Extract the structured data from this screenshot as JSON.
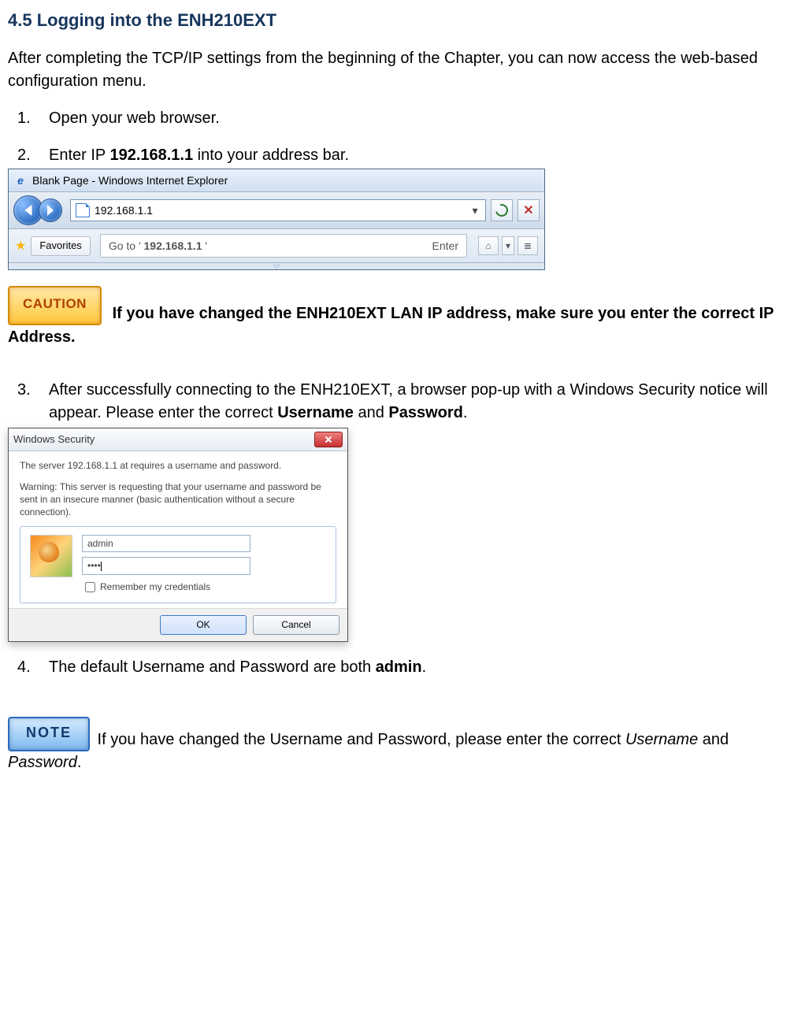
{
  "heading": "4.5 Logging into the ENH210EXT",
  "intro": "After completing the TCP/IP settings from the beginning of the Chapter, you can now access the web-based configuration menu.",
  "steps": {
    "s1": "Open your web browser.",
    "s2_pre": "Enter IP ",
    "s2_ip": "192.168.1.1",
    "s2_post": " into your address bar.",
    "s3_a": "After successfully connecting to the ENH210EXT, a browser pop-up with a Windows Security notice will appear. Please enter the correct ",
    "s3_user": "Username",
    "s3_and": " and ",
    "s3_pass": "Password",
    "s3_end": ".",
    "s4_a": "The default Username and Password are both ",
    "s4_val": "admin",
    "s4_end": "."
  },
  "caution": {
    "label": "CAUTION",
    "text": "If you have changed the ENH210EXT LAN IP address, make sure you enter the correct IP Address."
  },
  "note": {
    "label": "NOTE",
    "text_a": " If you have changed the Username and Password, please enter the correct ",
    "text_user": "Username",
    "text_and": " and ",
    "text_pass": "Password",
    "text_end": "."
  },
  "ie": {
    "title": "Blank Page - Windows Internet Explorer",
    "address": "192.168.1.1",
    "suggest_pre": "Go to ' ",
    "suggest_val": "192.168.1.1",
    "suggest_post": " '",
    "enter": "Enter",
    "favorites": "Favorites"
  },
  "dialog": {
    "title": "Windows Security",
    "line1": "The server 192.168.1.1 at  requires a username and password.",
    "line2": "Warning: This server is requesting that your username and password be sent in an insecure manner (basic authentication without a secure connection).",
    "username": "admin",
    "password": "••••",
    "remember": "Remember my credentials",
    "ok": "OK",
    "cancel": "Cancel"
  }
}
